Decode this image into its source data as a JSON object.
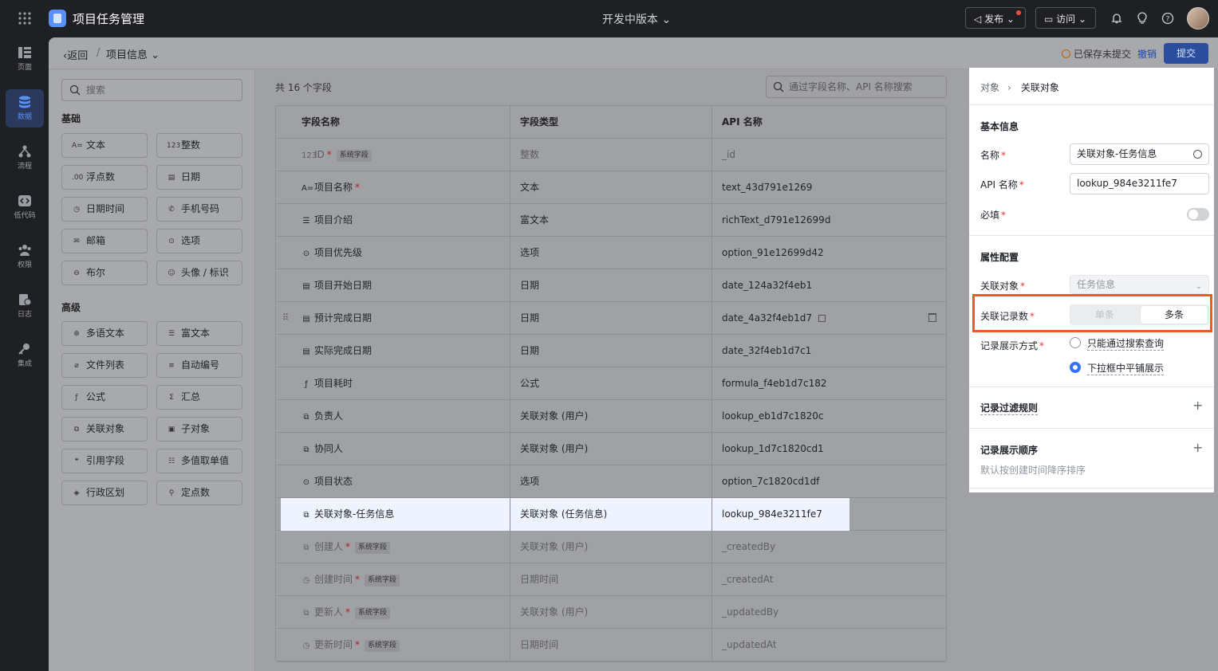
{
  "topbar": {
    "app_title": "项目任务管理",
    "env": "开发中版本",
    "publish": "发布",
    "visit": "访问"
  },
  "rail": [
    {
      "label": "页面",
      "icon": "layout-icon"
    },
    {
      "label": "数据",
      "icon": "database-icon",
      "active": true
    },
    {
      "label": "流程",
      "icon": "flow-icon"
    },
    {
      "label": "低代码",
      "icon": "code-icon"
    },
    {
      "label": "权限",
      "icon": "users-icon"
    },
    {
      "label": "日志",
      "icon": "log-icon"
    },
    {
      "label": "集成",
      "icon": "key-icon"
    }
  ],
  "subheader": {
    "back": "返回",
    "crumb": "项目信息",
    "save_status": "已保存未提交",
    "revoke": "撤销",
    "submit": "提交"
  },
  "palette": {
    "search_placeholder": "搜索",
    "basic_title": "基础",
    "basic": [
      {
        "label": "文本",
        "glyph": "A="
      },
      {
        "label": "整数",
        "glyph": "123"
      },
      {
        "label": "浮点数",
        "glyph": ".00"
      },
      {
        "label": "日期",
        "glyph": "▤"
      },
      {
        "label": "日期时间",
        "glyph": "◷"
      },
      {
        "label": "手机号码",
        "glyph": "✆"
      },
      {
        "label": "邮箱",
        "glyph": "✉"
      },
      {
        "label": "选项",
        "glyph": "⊙"
      },
      {
        "label": "布尔",
        "glyph": "⊖"
      },
      {
        "label": "头像 / 标识",
        "glyph": "☺"
      }
    ],
    "advanced_title": "高级",
    "advanced": [
      {
        "label": "多语文本",
        "glyph": "⊕"
      },
      {
        "label": "富文本",
        "glyph": "☰"
      },
      {
        "label": "文件列表",
        "glyph": "⌀"
      },
      {
        "label": "自动编号",
        "glyph": "≡"
      },
      {
        "label": "公式",
        "glyph": "ƒ"
      },
      {
        "label": "汇总",
        "glyph": "Σ"
      },
      {
        "label": "关联对象",
        "glyph": "⧉"
      },
      {
        "label": "子对象",
        "glyph": "▣"
      },
      {
        "label": "引用字段",
        "glyph": "❝"
      },
      {
        "label": "多值取单值",
        "glyph": "☷"
      },
      {
        "label": "行政区划",
        "glyph": "◈"
      },
      {
        "label": "定点数",
        "glyph": "⚲"
      }
    ]
  },
  "table": {
    "count": "共 16 个字段",
    "search_placeholder": "通过字段名称、API 名称搜索",
    "headers": [
      "字段名称",
      "字段类型",
      "API 名称"
    ],
    "sys_badge": "系统字段",
    "rows": [
      {
        "name": "ID",
        "glyph": "123",
        "type": "整数",
        "api": "_id",
        "system": true,
        "required": true
      },
      {
        "name": "项目名称",
        "glyph": "A=",
        "type": "文本",
        "api": "text_43d791e1269",
        "required": true
      },
      {
        "name": "项目介绍",
        "glyph": "☰",
        "type": "富文本",
        "api": "richText_d791e12699d"
      },
      {
        "name": "项目优先级",
        "glyph": "⊙",
        "type": "选项",
        "api": "option_91e12699d42"
      },
      {
        "name": "项目开始日期",
        "glyph": "▤",
        "type": "日期",
        "api": "date_124a32f4eb1"
      },
      {
        "name": "预计完成日期",
        "glyph": "▤",
        "type": "日期",
        "api": "date_4a32f4eb1d7",
        "hover": true
      },
      {
        "name": "实际完成日期",
        "glyph": "▤",
        "type": "日期",
        "api": "date_32f4eb1d7c1"
      },
      {
        "name": "项目耗时",
        "glyph": "ƒ",
        "type": "公式",
        "api": "formula_f4eb1d7c182"
      },
      {
        "name": "负责人",
        "glyph": "⧉",
        "type": "关联对象 (用户)",
        "api": "lookup_eb1d7c1820c"
      },
      {
        "name": "协同人",
        "glyph": "⧉",
        "type": "关联对象 (用户)",
        "api": "lookup_1d7c1820cd1"
      },
      {
        "name": "项目状态",
        "glyph": "⊙",
        "type": "选项",
        "api": "option_7c1820cd1df"
      },
      {
        "name": "关联对象-任务信息",
        "glyph": "⧉",
        "type": "关联对象 (任务信息)",
        "api": "lookup_984e3211fe7",
        "selected": true
      },
      {
        "name": "创建人",
        "glyph": "⧉",
        "type": "关联对象 (用户)",
        "api": "_createdBy",
        "system": true,
        "required": true
      },
      {
        "name": "创建时间",
        "glyph": "◷",
        "type": "日期时间",
        "api": "_createdAt",
        "system": true,
        "required": true
      },
      {
        "name": "更新人",
        "glyph": "⧉",
        "type": "关联对象 (用户)",
        "api": "_updatedBy",
        "system": true,
        "required": true
      },
      {
        "name": "更新时间",
        "glyph": "◷",
        "type": "日期时间",
        "api": "_updatedAt",
        "system": true,
        "required": true
      }
    ]
  },
  "panel": {
    "crumb_parent": "对象",
    "crumb_current": "关联对象",
    "basic_title": "基本信息",
    "name_label": "名称",
    "name_value": "关联对象-任务信息",
    "api_label": "API 名称",
    "api_value": "lookup_984e3211fe7",
    "required_label": "必填",
    "attr_title": "属性配置",
    "lookup_label": "关联对象",
    "lookup_value": "任务信息",
    "count_label": "关联记录数",
    "count_single": "单条",
    "count_multi": "多条",
    "display_label": "记录展示方式",
    "display_opt1": "只能通过搜索查询",
    "display_opt2": "下拉框中平铺展示",
    "filter_title": "记录过滤规则",
    "order_title": "记录展示顺序",
    "order_sub": "默认按创建时间降序排序"
  },
  "colors": {
    "accent": "#3370ff",
    "highlight_border": "#ef5a22",
    "required": "#e53935"
  }
}
